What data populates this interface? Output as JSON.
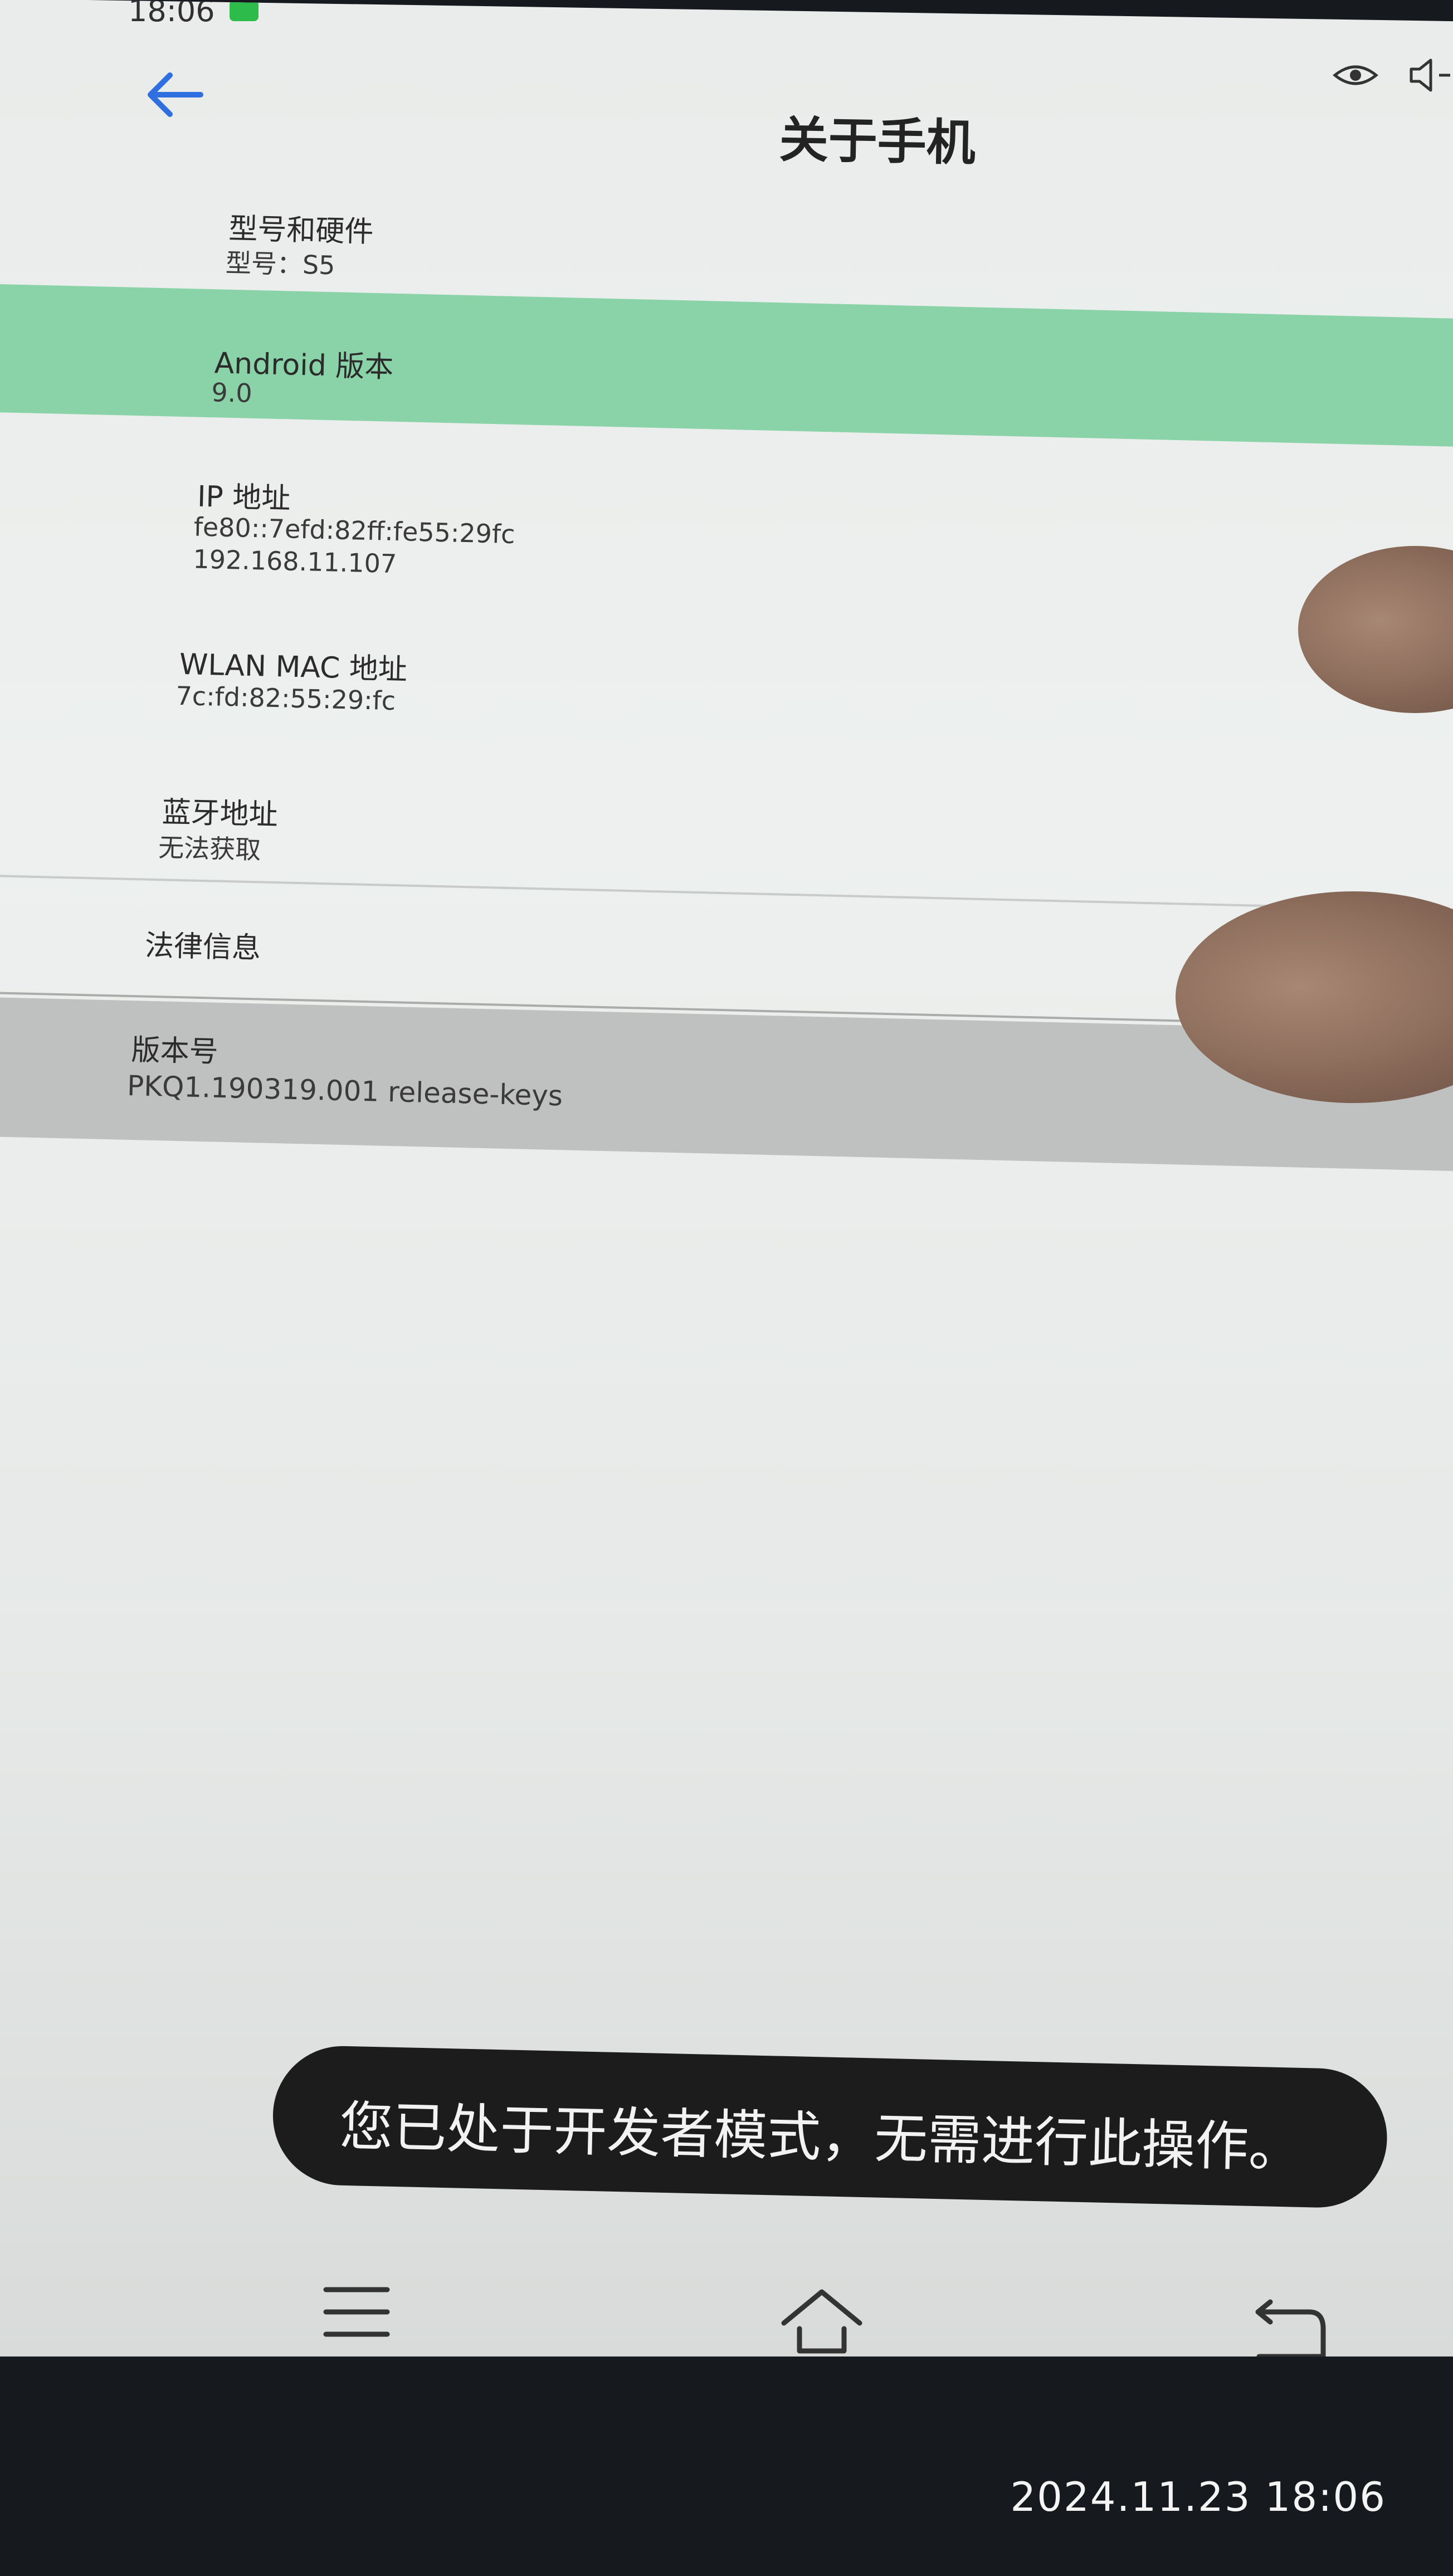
{
  "status_bar": {
    "time": "18:06"
  },
  "header": {
    "title": "关于手机"
  },
  "rows": [
    {
      "label": "型号和硬件",
      "values": [
        "型号：S5"
      ]
    },
    {
      "label": "Android 版本",
      "values": [
        "9.0"
      ]
    },
    {
      "label": "IP 地址",
      "values": [
        "fe80::7efd:82ff:fe55:29fc",
        "192.168.11.107"
      ]
    },
    {
      "label": "WLAN MAC 地址",
      "values": [
        "7c:fd:82:55:29:fc"
      ]
    },
    {
      "label": "蓝牙地址",
      "values": [
        "无法获取"
      ]
    },
    {
      "label": "法律信息",
      "values": []
    },
    {
      "label": "版本号",
      "values": [
        "PKQ1.190319.001 release-keys"
      ]
    }
  ],
  "toast": {
    "message": "您已处于开发者模式，无需进行此操作。"
  },
  "photo_timestamp": "2024.11.23   18:06",
  "icons": {
    "back": "back-arrow-icon",
    "eye": "eye-icon",
    "volume": "volume-icon",
    "menu": "menu-icon",
    "home": "home-icon",
    "back_nav": "return-icon"
  },
  "colors": {
    "highlight": "#8ad3a8",
    "pressed": "#bfc1c0",
    "accent": "#2f6fe0",
    "toast_bg": "#1c1c1c"
  }
}
